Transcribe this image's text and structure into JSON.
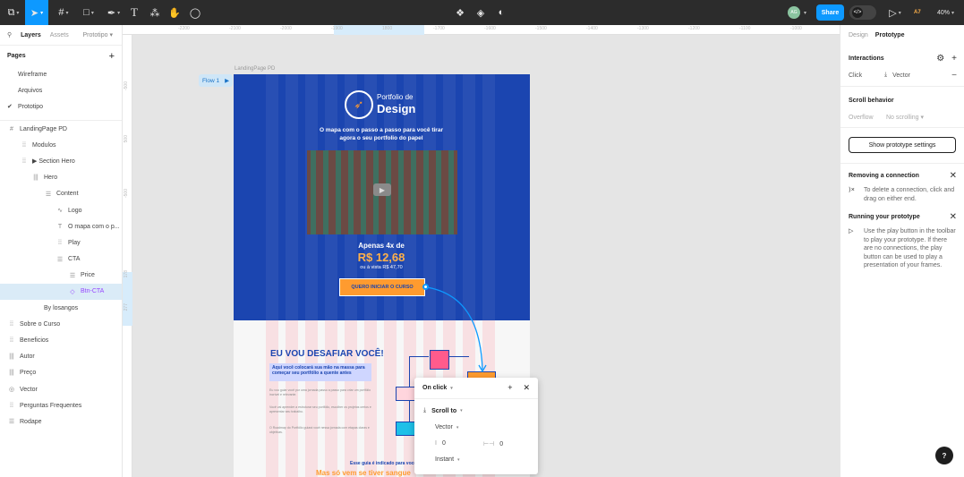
{
  "toolbar": {
    "share_label": "Share",
    "avatar_initials": "AG",
    "zoom": "40%",
    "collab_badge": "A7",
    "dev_mode_icon": "</>"
  },
  "left_panel": {
    "tabs": [
      "Layers",
      "Assets"
    ],
    "page_selector": "Prototipo",
    "pages_title": "Pages",
    "pages": [
      {
        "label": "Wireframe",
        "current": false
      },
      {
        "label": "Arquivos",
        "current": false
      },
      {
        "label": "Prototipo",
        "current": true
      }
    ],
    "layers": [
      {
        "label": "LandingPage PD",
        "icon": "#",
        "indent": 8,
        "selected": false
      },
      {
        "label": "Modulos",
        "icon": "⁞⁞",
        "indent": 22,
        "selected": false
      },
      {
        "label": "▶ Section Hero",
        "icon": "⁞⁞",
        "indent": 22,
        "selected": false
      },
      {
        "label": "Hero",
        "icon": "|||",
        "indent": 35,
        "selected": false
      },
      {
        "label": "Content",
        "icon": "☰",
        "indent": 49,
        "selected": false
      },
      {
        "label": "Logo",
        "icon": "∿",
        "indent": 62,
        "selected": false
      },
      {
        "label": "O mapa com o p...",
        "icon": "T",
        "indent": 62,
        "selected": false
      },
      {
        "label": "Play",
        "icon": "⁞⁞",
        "indent": 62,
        "selected": false
      },
      {
        "label": "CTA",
        "icon": "☰",
        "indent": 62,
        "selected": false
      },
      {
        "label": "Price",
        "icon": "☰",
        "indent": 76,
        "selected": false
      },
      {
        "label": "Btn-CTA",
        "icon": "◇",
        "indent": 76,
        "selected": true
      },
      {
        "label": "By losangos",
        "icon": "",
        "indent": 35,
        "selected": false
      },
      {
        "label": "Sobre o Curso",
        "icon": "⁞⁞",
        "indent": 8,
        "selected": false
      },
      {
        "label": "Beneficios",
        "icon": "⁞⁞",
        "indent": 8,
        "selected": false
      },
      {
        "label": "Autor",
        "icon": "|||",
        "indent": 8,
        "selected": false
      },
      {
        "label": "Preço",
        "icon": "|||",
        "indent": 8,
        "selected": false
      },
      {
        "label": "Vector",
        "icon": "◎",
        "indent": 8,
        "selected": false
      },
      {
        "label": "Perguntas Frequentes",
        "icon": "⁞⁞",
        "indent": 8,
        "selected": false
      },
      {
        "label": "Rodape",
        "icon": "☰",
        "indent": 8,
        "selected": false
      }
    ]
  },
  "canvas": {
    "frame_name": "LandingPage PD",
    "flow_label": "Flow 1",
    "ruler_top": [
      "-2200",
      "-2100",
      "-2000",
      "-1900",
      "1800",
      "-1700",
      "-1600",
      "-1500",
      "-1400",
      "-1300",
      "-1200",
      "-1100",
      "-1000"
    ],
    "ruler_left": [
      "-500",
      "500",
      "-500",
      "178",
      "277"
    ],
    "page": {
      "logo_line1": "Portfolio de",
      "logo_line2": "Design",
      "headline": "O mapa com o passo a passo para você tirar agora o seu portfolio do papel",
      "price_label": "Apenas 4x de",
      "price_value": "R$ 12,68",
      "price_note": "ou à vista R$ 47,70",
      "cta_label": "QUERO INICIAR O CURSO",
      "section_title": "EU VOU DESAFIAR VOCÊ!",
      "section_box": "Aqui você colocará sua mão na massa para começar seu portfólio a quente antes",
      "paragraphs": [
        "Eu vou guiar você por uma jornada passo a passo para criar um portfólio incrível e relevante.",
        "Você vai aprender a estruturar seu portfólio, escolher os projetos certos e apresentar seu trabalho.",
        "O Roadmap do Portfólio guiará você nessa jornada com etapas claras e objetivas."
      ],
      "footer_line1": "Esse guia é indicado para você De",
      "footer_line2": "Mas só vem se tiver sangue"
    },
    "popup": {
      "title": "On click",
      "action": "Scroll to",
      "target": "Vector",
      "offset_x": "0",
      "offset_y": "0",
      "animation": "Instant"
    }
  },
  "right_panel": {
    "tabs": [
      "Design",
      "Prototype"
    ],
    "interactions_title": "Interactions",
    "trigger": "Click",
    "destination": "Vector",
    "scroll_title": "Scroll behavior",
    "overflow_label": "Overflow",
    "overflow_value": "No scrolling",
    "settings_button": "Show prototype settings",
    "removing_title": "Removing a connection",
    "removing_text": "To delete a connection, click and drag on either end.",
    "running_title": "Running your prototype",
    "running_text": "Use the play button in the toolbar to play your prototype. If there are no connections, the play button can be used to play a presentation of your frames.",
    "help_label": "?"
  },
  "colors": {
    "accent": "#0d99ff",
    "hero_blue": "#1b45b0",
    "cta_orange": "#ff9b2f",
    "selection": "#9747ff"
  }
}
